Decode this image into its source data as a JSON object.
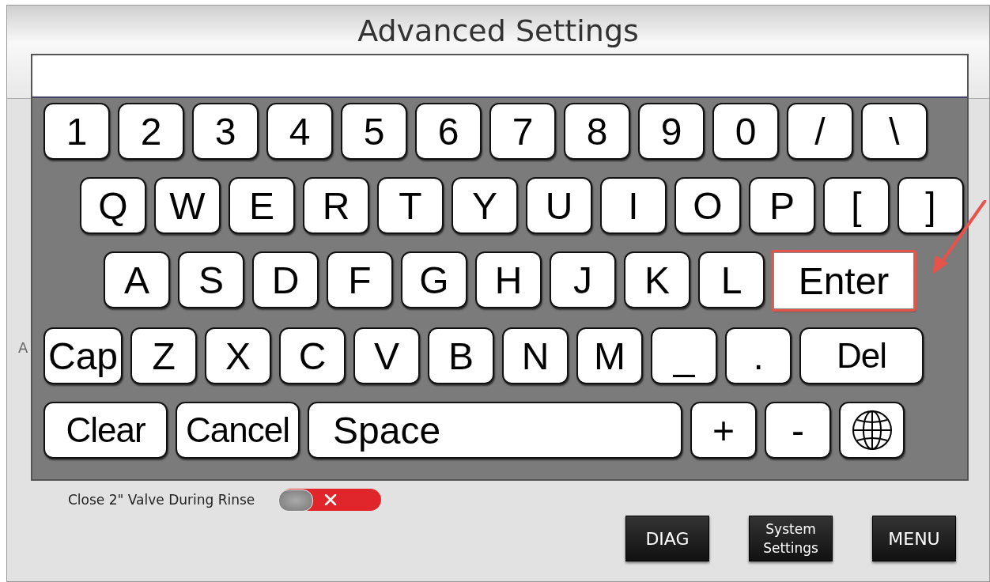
{
  "screen": {
    "title": "Advanced Settings",
    "partial_label": "A"
  },
  "setting": {
    "label": "Close 2\" Valve During Rinse",
    "on": false
  },
  "buttons": [
    {
      "lines": [
        "DIAG"
      ]
    },
    {
      "lines": [
        "System",
        "Settings"
      ]
    },
    {
      "lines": [
        "MENU"
      ]
    }
  ],
  "keyboard": {
    "rows": [
      {
        "keys": [
          {
            "kind": "key",
            "label": "1"
          },
          {
            "kind": "key",
            "label": "2"
          },
          {
            "kind": "key",
            "label": "3"
          },
          {
            "kind": "key",
            "label": "4"
          },
          {
            "kind": "key",
            "label": "5"
          },
          {
            "kind": "key",
            "label": "6"
          },
          {
            "kind": "key",
            "label": "7"
          },
          {
            "kind": "key",
            "label": "8"
          },
          {
            "kind": "key",
            "label": "9"
          },
          {
            "kind": "key",
            "label": "0"
          },
          {
            "kind": "key",
            "label": "/"
          },
          {
            "kind": "key",
            "label": "\\"
          }
        ]
      },
      {
        "keys": [
          {
            "kind": "key",
            "label": "Q"
          },
          {
            "kind": "key",
            "label": "W"
          },
          {
            "kind": "key",
            "label": "E"
          },
          {
            "kind": "key",
            "label": "R"
          },
          {
            "kind": "key",
            "label": "T"
          },
          {
            "kind": "key",
            "label": "Y"
          },
          {
            "kind": "key",
            "label": "U"
          },
          {
            "kind": "key",
            "label": "I"
          },
          {
            "kind": "key",
            "label": "O"
          },
          {
            "kind": "key",
            "label": "P"
          },
          {
            "kind": "key",
            "label": "["
          },
          {
            "kind": "key",
            "label": "]"
          }
        ]
      },
      {
        "keys": [
          {
            "kind": "key",
            "label": "A"
          },
          {
            "kind": "key",
            "label": "S"
          },
          {
            "kind": "key",
            "label": "D"
          },
          {
            "kind": "key",
            "label": "F"
          },
          {
            "kind": "key",
            "label": "G"
          },
          {
            "kind": "key",
            "label": "H"
          },
          {
            "kind": "key",
            "label": "J"
          },
          {
            "kind": "key",
            "label": "K"
          },
          {
            "kind": "key",
            "label": "L"
          },
          {
            "kind": "enter",
            "label": "Enter",
            "annotated": true
          }
        ]
      },
      {
        "keys": [
          {
            "kind": "key",
            "label": "Cap"
          },
          {
            "kind": "key",
            "label": "Z"
          },
          {
            "kind": "key",
            "label": "X"
          },
          {
            "kind": "key",
            "label": "C"
          },
          {
            "kind": "key",
            "label": "V"
          },
          {
            "kind": "key",
            "label": "B"
          },
          {
            "kind": "key",
            "label": "N"
          },
          {
            "kind": "key",
            "label": "M"
          },
          {
            "kind": "key",
            "label": "_"
          },
          {
            "kind": "key",
            "label": "."
          },
          {
            "kind": "wide",
            "label": "Del"
          }
        ]
      },
      {
        "keys": [
          {
            "kind": "wide",
            "label": "Clear"
          },
          {
            "kind": "wide",
            "label": "Cancel"
          },
          {
            "kind": "space",
            "label": "Space"
          },
          {
            "kind": "key",
            "label": "+"
          },
          {
            "kind": "key",
            "label": "-"
          },
          {
            "kind": "globe"
          }
        ]
      }
    ]
  }
}
